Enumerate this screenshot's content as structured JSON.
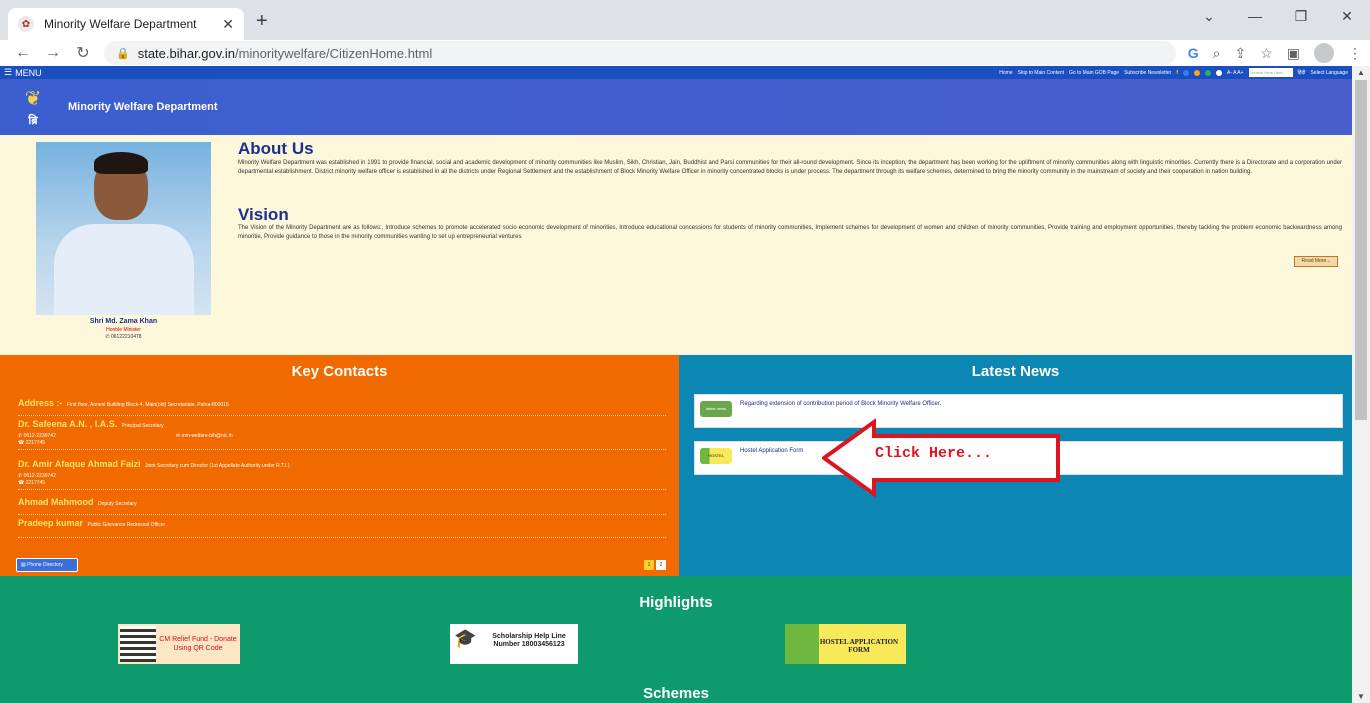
{
  "browser": {
    "tab_title": "Minority Welfare Department",
    "url_host": "state.bihar.gov.in",
    "url_path": "/minoritywelfare/CitizenHome.html"
  },
  "topnav": {
    "menu_label": "MENU",
    "home": "Home",
    "skip": "Skip to Main Content",
    "gob": "Go to Main GOB Page",
    "newsletter": "Subscribe Newsletter",
    "font_sizes": "A- A A+",
    "search_placeholder": "Search Here Here",
    "hindi": "हिंदी",
    "language": "Select Language"
  },
  "header": {
    "emblem_text": "ब्रि",
    "brand": "Minority Welfare Department"
  },
  "about": {
    "title": "About Us",
    "text": "Minority Welfare Department was established in 1991 to provide financial, social and academic development of minority communities like Muslim, Sikh, Christian, Jain, Buddhist and Parsi communities for their all-round development. Since its inception, the department has been working for the upliftment of minority communities along with linguistic minorities. Currently there is a Directorate and a corporation under departmental establishment. District minority welfare officer is established in all the districts under Regional Settlement and the establishment of Block Minority Welfare Officer in minority concentrated blocks is under process. The department through its welfare schemes, determined to bring the minority community in the mainstream of society and their cooperation in nation building.",
    "vision_title": "Vision",
    "vision_text": "The Vision of the Minority Department are as follows:, Introduce schemes to promote accelerated socio economic development of minorities, Introduce educational concessions for students of minority communities, Implement schemes for development of women and children of minority communities, Provide training and employment opportunities, thereby tackling the problem economic backwardness among minoritie, Provide guidance to those in the minority communities wanting to set up entrepreneurial ventures",
    "read_more": "Read More...",
    "minister_name": "Shri Md. Zama Khan",
    "minister_role": "Honble Minister",
    "minister_phone": "✆ 06122210478"
  },
  "contacts": {
    "title": "Key Contacts",
    "address_label": "Address :-",
    "address": "First floor, Annexi Building Block-4, Main(old) Secretariate, Patna-800015",
    "people": [
      {
        "name": "Dr. Safeena A.N. , I.A.S.",
        "designation": "Principal Secretary",
        "phone": "0612-2230742",
        "email": "mm-welfare-bih@nic.in",
        "fax": "2217745"
      },
      {
        "name": "Dr. Amir Afaque Ahmad Faizi",
        "designation": "Joint Secretary cum Director (1st Appellate Authority under R.T.I.)",
        "phone": "0612-2230742",
        "fax": "2217745"
      },
      {
        "name": "Ahmad Mahmood",
        "designation": "Deputy Secretary"
      },
      {
        "name": "Pradeep kumar",
        "designation": "Public Grievance Redressal Officer"
      }
    ],
    "phone_directory": "Phone Directory",
    "pages": [
      "1",
      "2"
    ]
  },
  "news": {
    "title": "Latest News",
    "items": [
      {
        "thumb": "latest news",
        "text": "Regarding extension of contribution period of Block Minority Welfare Officer."
      },
      {
        "thumb": "HOSTEL",
        "text": "Hostel Application Form"
      }
    ],
    "callout": "Click Here..."
  },
  "highlights": {
    "title": "Highlights",
    "cm_relief": "CM Relief Fund - Donate Using QR Code",
    "scholarship": "Scholarship Help Line Number 18003456123",
    "hostel": "HOSTEL APPLICATION FORM",
    "schemes": "Schemes"
  },
  "colors": {
    "topnav": "#1b4fbf",
    "header": "#3b5fcf",
    "about_bg": "#fdf8dc",
    "contacts_bg": "#f06a00",
    "news_bg": "#0c87b3",
    "highlights_bg": "#0e9a6d",
    "callout": "#e0141e"
  }
}
